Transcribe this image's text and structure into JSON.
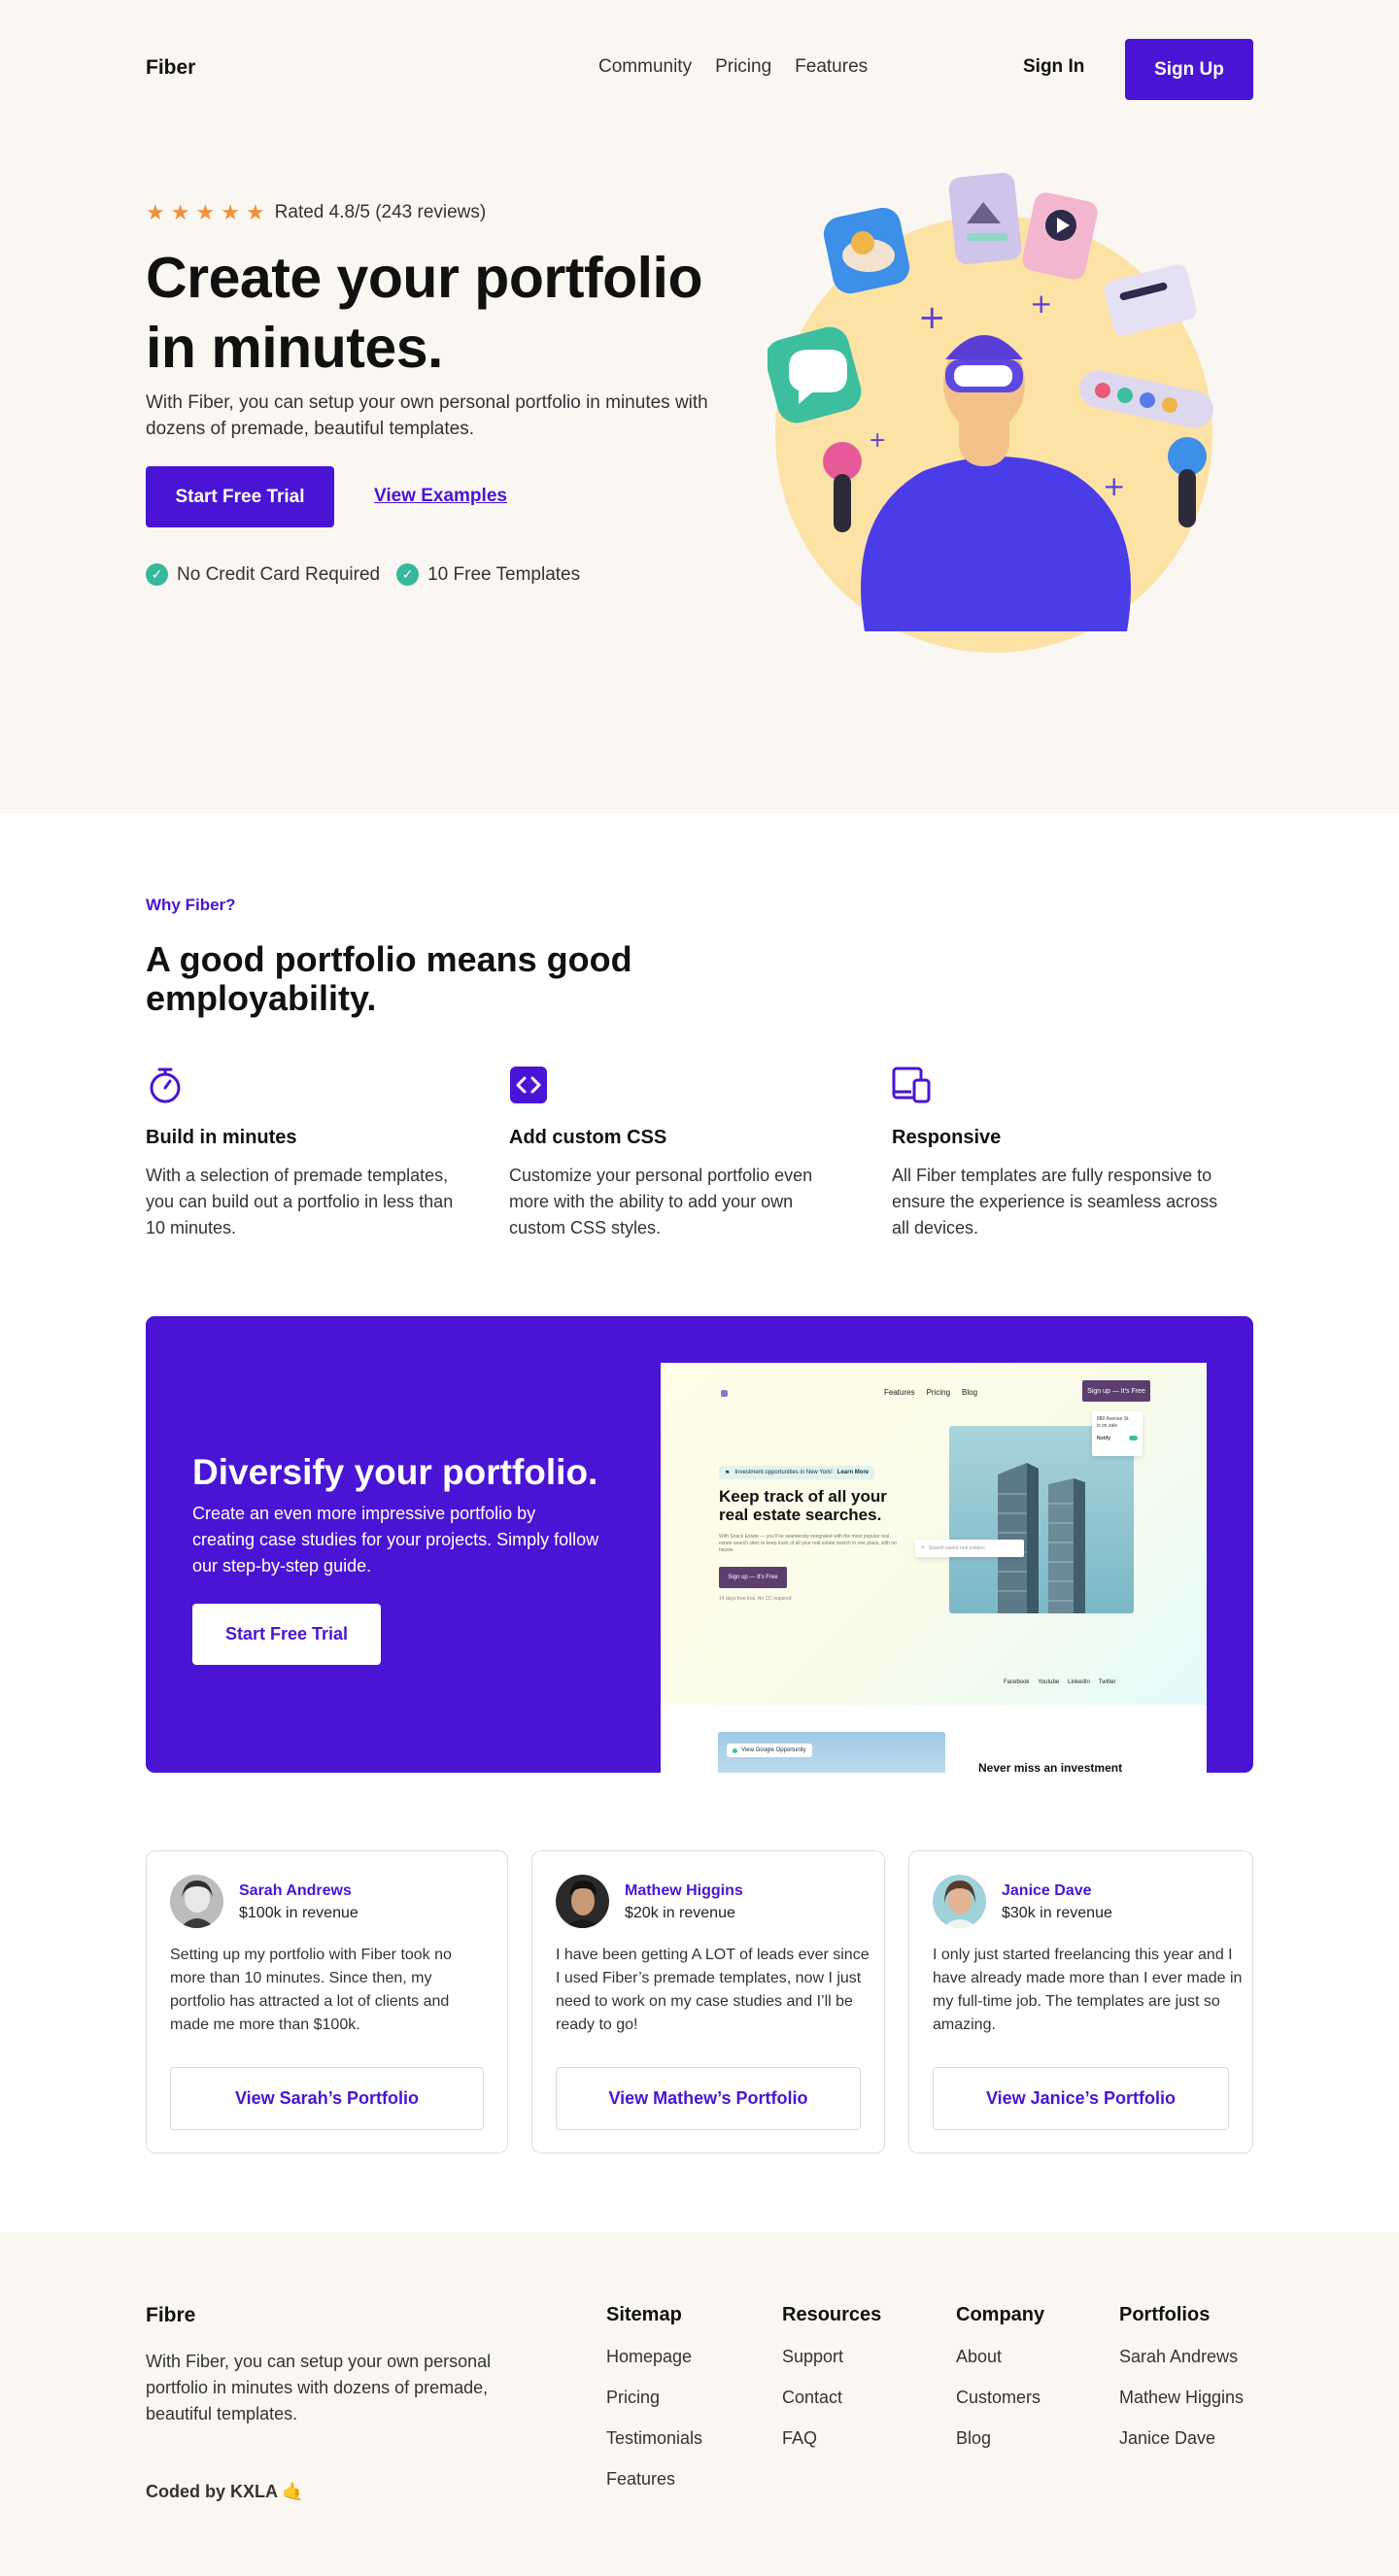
{
  "nav": {
    "logo": "Fiber",
    "links": [
      "Community",
      "Pricing",
      "Features"
    ],
    "sign_in": "Sign In",
    "sign_up": "Sign Up"
  },
  "hero": {
    "rating_text": "Rated 4.8/5 (243 reviews)",
    "rating_stars": 5,
    "title": "Create your portfolio in minutes.",
    "description": "With Fiber, you can setup your own personal portfolio in minutes with dozens of premade, beautiful templates.",
    "cta_primary": "Start Free Trial",
    "cta_secondary": "View Examples",
    "checks": [
      "No Credit Card Required",
      "10 Free Templates"
    ]
  },
  "why": {
    "label": "Why Fiber?",
    "title": "A good portfolio means good employability.",
    "features": [
      {
        "title": "Build in minutes",
        "text": "With a selection of premade templates, you can build out a portfolio in less than 10 minutes.",
        "icon": "stopwatch-icon"
      },
      {
        "title": "Add custom CSS",
        "text": "Customize your personal portfolio even more with the ability to add your own custom CSS styles.",
        "icon": "code-icon"
      },
      {
        "title": "Responsive",
        "text": "All Fiber templates are fully responsive to ensure the experience is seamless across all devices.",
        "icon": "devices-icon"
      }
    ]
  },
  "promo": {
    "title": "Diversify your portfolio.",
    "description": "Create an even more impressive portfolio by creating case studies for your projects. Simply follow our step-by-step guide.",
    "cta": "Start Free Trial",
    "mock": {
      "nav_links": [
        "Features",
        "Pricing",
        "Blog"
      ],
      "nav_button": "Sign up — It's Free",
      "tag": "Investment opportunities in New York!",
      "tag_link": "Learn More",
      "heading": "Keep track of all your real estate searches.",
      "body": "With Snack Estate — you'll be seamlessly integrated with the most popular real estate search sites to keep track of all your real estate search in one place, with no hassle.",
      "button": "Sign up — It's Free",
      "note": "14 days free trial, No CC required",
      "search_placeholder": "Search saved real estates",
      "card_line1": "880 Avenue St.",
      "card_line2": "is on sale",
      "card_line3": "Notify",
      "footer_links": [
        "Facebook",
        "Youtube",
        "LinkedIn",
        "Twitter"
      ],
      "second_tag": "View Google Opportunity",
      "second_heading": "Never miss an investment"
    }
  },
  "testimonials": [
    {
      "name": "Sarah Andrews",
      "revenue": "$100k in revenue",
      "text": "Setting up my portfolio with Fiber took no more than 10 minutes. Since then, my portfolio has attracted a lot of clients and made me more than $100k.",
      "button": "View Sarah’s Portfolio"
    },
    {
      "name": "Mathew Higgins",
      "revenue": "$20k in revenue",
      "text": "I have been getting A LOT of leads ever since I used Fiber’s premade templates, now I just need to work on my case studies and I’ll be ready to go!",
      "button": "View Mathew’s Portfolio"
    },
    {
      "name": "Janice Dave",
      "revenue": "$30k in revenue",
      "text": "I only just started freelancing this year and I have already made more than I ever made in my full-time job. The templates are just so amazing.",
      "button": "View Janice’s Portfolio"
    }
  ],
  "footer": {
    "brand": "Fibre",
    "description": "With Fiber, you can setup your own personal portfolio in minutes with dozens of premade, beautiful templates.",
    "coded_by": "Coded by KXLA 🤙",
    "columns": [
      {
        "title": "Sitemap",
        "items": [
          "Homepage",
          "Pricing",
          "Testimonials",
          "Features"
        ]
      },
      {
        "title": "Resources",
        "items": [
          "Support",
          "Contact",
          "FAQ"
        ]
      },
      {
        "title": "Company",
        "items": [
          "About",
          "Customers",
          "Blog"
        ]
      },
      {
        "title": "Portfolios",
        "items": [
          "Sarah Andrews",
          "Mathew Higgins",
          "Janice Dave"
        ]
      }
    ]
  },
  "colors": {
    "accent": "#4a14d4",
    "star": "#f0913a",
    "check": "#35b89c",
    "beige": "#faf7f3"
  }
}
